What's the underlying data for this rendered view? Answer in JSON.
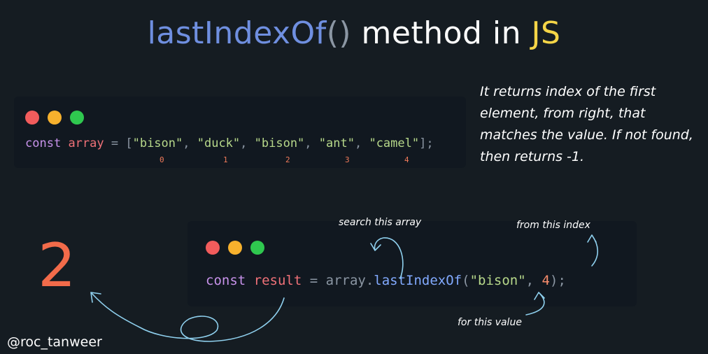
{
  "title": {
    "method": "lastIndexOf",
    "parens": "()",
    "middle": " method in ",
    "lang": "JS"
  },
  "snippet1": {
    "kw": "const",
    "name": "array",
    "eq": " = ",
    "open": "[",
    "items": [
      "\"bison\"",
      "\"duck\"",
      "\"bison\"",
      "\"ant\"",
      "\"camel\""
    ],
    "sep": ", ",
    "close": "];",
    "indices": [
      "0",
      "1",
      "2",
      "3",
      "4"
    ]
  },
  "note": "It returns index of the first element, from right, that matches the value. If not found, then returns -1.",
  "snippet2": {
    "kw": "const",
    "name": "result",
    "eq": " = ",
    "obj": "array",
    "dot": ".",
    "method": "lastIndexOf",
    "paren_open": "(",
    "arg_str": "\"bison\"",
    "comma": ", ",
    "arg_num": "4",
    "paren_close": ");"
  },
  "result_value": "2",
  "annotations": {
    "search": "search this array",
    "index": "from this index",
    "value": "for this value"
  },
  "handle": "@roc_tanweer",
  "colors": {
    "background": "#151c22",
    "method": "#6f8fe0",
    "js": "#f5d547",
    "result": "#f26b4a",
    "arrow": "#8fd0ee"
  }
}
